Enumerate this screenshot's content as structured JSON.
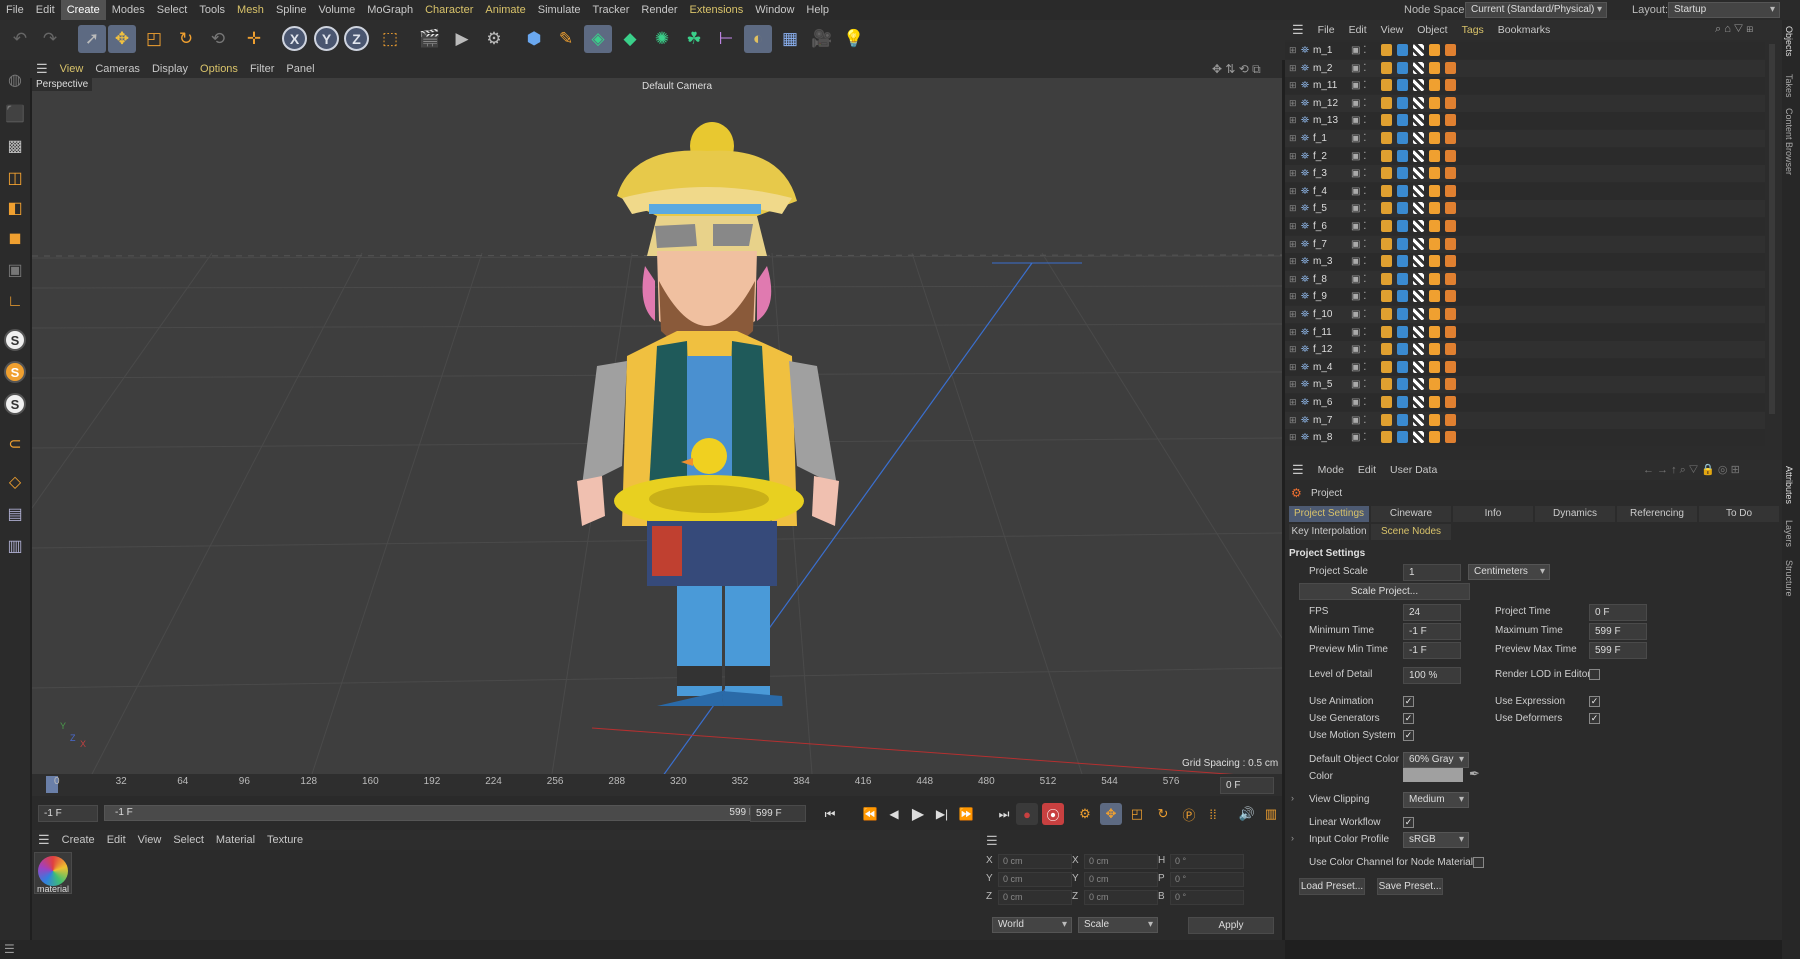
{
  "menubar": {
    "items": [
      "File",
      "Edit",
      "Create",
      "Modes",
      "Select",
      "Tools",
      "Mesh",
      "Spline",
      "Volume",
      "MoGraph",
      "Character",
      "Animate",
      "Simulate",
      "Tracker",
      "Render",
      "Extensions",
      "Window",
      "Help"
    ],
    "node_space_label": "Node Space:",
    "node_space_value": "Current (Standard/Physical)",
    "layout_label": "Layout:",
    "layout_value": "Startup"
  },
  "viewport": {
    "menu": [
      "View",
      "Cameras",
      "Display",
      "Options",
      "Filter",
      "Panel"
    ],
    "label": "Perspective",
    "camera": "Default Camera",
    "grid_spacing": "Grid Spacing : 0.5 cm",
    "axis_y": "Y",
    "axis_z": "Z",
    "axis_x": "X"
  },
  "timeline": {
    "ticks": [
      "0",
      "32",
      "64",
      "96",
      "128",
      "160",
      "192",
      "224",
      "256",
      "288",
      "320",
      "352",
      "384",
      "416",
      "448",
      "480",
      "512",
      "544",
      "576"
    ],
    "current_frame": "0 F",
    "range_start": "-1 F",
    "range_slider_start": "-1 F",
    "range_slider_end": "599 F",
    "range_end": "599 F"
  },
  "material_manager": {
    "menu": [
      "Create",
      "Edit",
      "View",
      "Select",
      "Material",
      "Texture"
    ],
    "material_name": "material"
  },
  "coordinates": {
    "rows": [
      {
        "a": "X",
        "av": "0 cm",
        "b": "X",
        "bv": "0 cm",
        "c": "H",
        "cv": "0 °"
      },
      {
        "a": "Y",
        "av": "0 cm",
        "b": "Y",
        "bv": "0 cm",
        "c": "P",
        "cv": "0 °"
      },
      {
        "a": "Z",
        "av": "0 cm",
        "b": "Z",
        "bv": "0 cm",
        "c": "B",
        "cv": "0 °"
      }
    ],
    "mode_world": "World",
    "mode_scale": "Scale",
    "apply": "Apply"
  },
  "object_manager": {
    "menu": [
      "File",
      "Edit",
      "View",
      "Object",
      "Tags",
      "Bookmarks"
    ],
    "objects": [
      "m_1",
      "m_2",
      "m_11",
      "m_12",
      "m_13",
      "f_1",
      "f_2",
      "f_3",
      "f_4",
      "f_5",
      "f_6",
      "f_7",
      "m_3",
      "f_8",
      "f_9",
      "f_10",
      "f_11",
      "f_12",
      "m_4",
      "m_5",
      "m_6",
      "m_7",
      "m_8"
    ]
  },
  "attributes": {
    "menu": [
      "Mode",
      "Edit",
      "User Data"
    ],
    "object": "Project",
    "tabs": [
      "Project Settings",
      "Cineware",
      "Info",
      "Dynamics",
      "Referencing",
      "To Do"
    ],
    "tabs2": [
      "Key Interpolation",
      "Scene Nodes"
    ],
    "section": "Project Settings",
    "project_scale_label": "Project Scale",
    "project_scale_value": "1",
    "project_scale_unit": "Centimeters",
    "scale_project_button": "Scale Project...",
    "fps_label": "FPS",
    "fps_value": "24",
    "project_time_label": "Project Time",
    "project_time_value": "0 F",
    "min_time_label": "Minimum Time",
    "min_time_value": "-1 F",
    "max_time_label": "Maximum Time",
    "max_time_value": "599 F",
    "prev_min_label": "Preview Min Time",
    "prev_min_value": "-1 F",
    "prev_max_label": "Preview Max Time",
    "prev_max_value": "599 F",
    "lod_label": "Level of Detail",
    "lod_value": "100 %",
    "render_lod_label": "Render LOD in Editor",
    "use_animation": "Use Animation",
    "use_expression": "Use Expression",
    "use_generators": "Use Generators",
    "use_deformers": "Use Deformers",
    "use_motion": "Use Motion System",
    "default_color_label": "Default Object Color",
    "default_color_value": "60% Gray",
    "color_label": "Color",
    "view_clipping_label": "View Clipping",
    "view_clipping_value": "Medium",
    "linear_workflow": "Linear Workflow",
    "input_profile_label": "Input Color Profile",
    "input_profile_value": "sRGB",
    "color_channel_label": "Use Color Channel for Node Material",
    "load_preset": "Load Preset...",
    "save_preset": "Save Preset..."
  },
  "side_tabs": [
    "Objects",
    "Takes",
    "Content Browser",
    "Attributes",
    "Layers",
    "Structure"
  ],
  "colors": {
    "accent": "#d9c36a",
    "selection": "#4d5a72",
    "viewport": "#3e3e3e"
  }
}
